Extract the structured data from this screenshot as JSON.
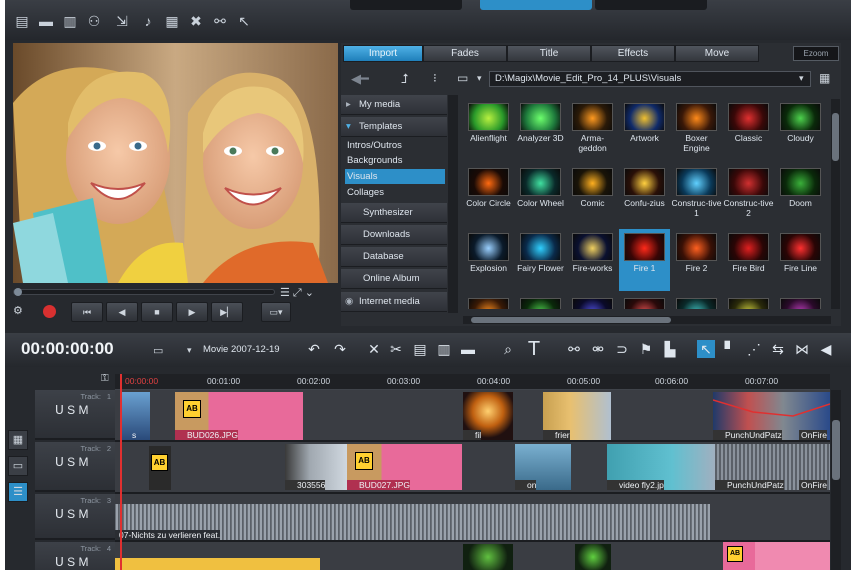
{
  "toolbar": {
    "icons": [
      "new-file-icon",
      "open-folder-icon",
      "save-icon",
      "burn-icon",
      "export-icon",
      "music-icon",
      "film-icon",
      "cursor-mode-icon",
      "link-icon",
      "help-icon"
    ]
  },
  "media_pool": {
    "tabs": [
      "Import",
      "Fades",
      "Title",
      "Effects",
      "Move"
    ],
    "logo": "Ezoom",
    "path": "D:\\Magix\\Movie_Edit_Pro_14_PLUS\\Visuals",
    "nav": {
      "my_media": "My media",
      "templates": "Templates",
      "template_items": [
        "Intros/Outros",
        "Backgrounds",
        "Visuals",
        "Collages"
      ],
      "selected_item": "Visuals",
      "synthesizer": "Synthesizer",
      "downloads": "Downloads",
      "database": "Database",
      "online_album": "Online Album",
      "internet_media": "Internet media"
    },
    "visuals": [
      {
        "label": "Alienflight",
        "c1": "#2a9a2a",
        "c2": "#b8f040"
      },
      {
        "label": "Analyzer 3D",
        "c1": "#1e7a3c",
        "c2": "#6dff6d"
      },
      {
        "label": "Arma-geddon",
        "c1": "#2b1a08",
        "c2": "#ff9a20"
      },
      {
        "label": "Artwork",
        "c1": "#0f2a6a",
        "c2": "#f0c030"
      },
      {
        "label": "Boxer Engine",
        "c1": "#3a1808",
        "c2": "#ff8a1a"
      },
      {
        "label": "Classic",
        "c1": "#3a0808",
        "c2": "#e03030"
      },
      {
        "label": "Cloudy",
        "c1": "#0a2a0a",
        "c2": "#4dd24d"
      },
      {
        "label": "Color Circle",
        "c1": "#1a0a05",
        "c2": "#ff6a10"
      },
      {
        "label": "Color Wheel",
        "c1": "#0a2a2a",
        "c2": "#40e0a0"
      },
      {
        "label": "Comic",
        "c1": "#1a1408",
        "c2": "#ffb020"
      },
      {
        "label": "Confu-zius",
        "c1": "#2a1008",
        "c2": "#ffd040"
      },
      {
        "label": "Construc-tive 1",
        "c1": "#0a3a5a",
        "c2": "#60d0ff"
      },
      {
        "label": "Construc-tive 2",
        "c1": "#3a0808",
        "c2": "#d03030"
      },
      {
        "label": "Doom",
        "c1": "#0a2a0a",
        "c2": "#3ab03a"
      },
      {
        "label": "Explosion",
        "c1": "#0a1a2a",
        "c2": "#9ad0ff"
      },
      {
        "label": "Fairy Flower",
        "c1": "#0a2a4a",
        "c2": "#30d0ff"
      },
      {
        "label": "Fire-works",
        "c1": "#0a1030",
        "c2": "#f0d060"
      },
      {
        "label": "Fire 1",
        "c1": "#3a0505",
        "c2": "#ff2a1a"
      },
      {
        "label": "Fire 2",
        "c1": "#3a1005",
        "c2": "#ff6020"
      },
      {
        "label": "Fire Bird",
        "c1": "#2a0505",
        "c2": "#e02020"
      },
      {
        "label": "Fire Line",
        "c1": "#2a0505",
        "c2": "#ff3030"
      },
      {
        "label": "",
        "c1": "#3a1a05",
        "c2": "#ff9020"
      },
      {
        "label": "",
        "c1": "#0a2a0a",
        "c2": "#50d050"
      },
      {
        "label": "",
        "c1": "#0a0a2a",
        "c2": "#5050e0"
      },
      {
        "label": "",
        "c1": "#2a0a0a",
        "c2": "#e05050"
      },
      {
        "label": "",
        "c1": "#0a2a2a",
        "c2": "#40c0c0"
      },
      {
        "label": "",
        "c1": "#2a2a0a",
        "c2": "#d0d040"
      },
      {
        "label": "",
        "c1": "#2a0a2a",
        "c2": "#c040c0"
      }
    ],
    "selected_visual": "Fire 1"
  },
  "editor": {
    "timecode": "00:00:00:00",
    "movie_name": "Movie 2007-12-19"
  },
  "timeline": {
    "ruler": [
      "00:00:00",
      "00:01:00",
      "00:02:00",
      "00:03:00",
      "00:04:00",
      "00:05:00",
      "00:06:00",
      "00:07:00"
    ],
    "tracks": [
      {
        "label": "Track:",
        "num": "1",
        "controls": "ᑌ S M"
      },
      {
        "label": "Track:",
        "num": "2",
        "controls": "ᑌ S M"
      },
      {
        "label": "Track:",
        "num": "3",
        "controls": "ᑌ S M"
      },
      {
        "label": "Track:",
        "num": "4",
        "controls": "ᑌ S M"
      }
    ],
    "clip_labels": {
      "t1_a": "s",
      "t1_b": "BUD026.JPG",
      "t1_c": "fil",
      "t1_d": "frier",
      "t1_e": "PunchUndPatz",
      "t1_f": "OnFire",
      "t2_a": "303556",
      "t2_b": "BUD027.JPG",
      "t2_c": "on",
      "t2_d": "video fly2.jp",
      "t2_e": "PunchUndPatz",
      "t2_f": "OnFire",
      "t3_a": "07-Nichts zu verlieren feat."
    }
  }
}
